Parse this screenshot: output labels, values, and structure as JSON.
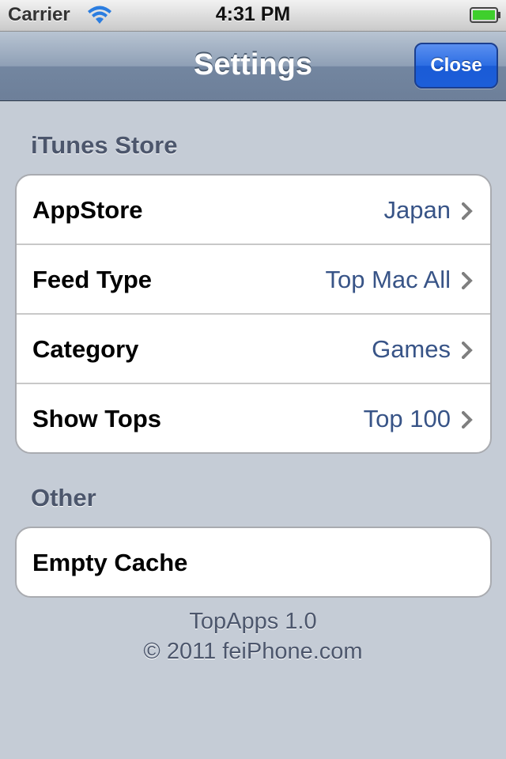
{
  "status_bar": {
    "carrier": "Carrier",
    "time": "4:31 PM",
    "wifi_icon": "wifi-icon",
    "battery_icon": "battery-full-icon",
    "battery_color": "#3fcf2d"
  },
  "nav_bar": {
    "title": "Settings",
    "close_label": "Close",
    "accent_color": "#1c5ed9"
  },
  "sections": {
    "itunes": {
      "header": "iTunes Store",
      "rows": [
        {
          "label": "AppStore",
          "value": "Japan"
        },
        {
          "label": "Feed Type",
          "value": "Top Mac All"
        },
        {
          "label": "Category",
          "value": "Games"
        },
        {
          "label": "Show Tops",
          "value": "Top 100"
        }
      ]
    },
    "other": {
      "header": "Other",
      "rows": [
        {
          "label": "Empty Cache"
        }
      ]
    }
  },
  "footer": {
    "version": "TopApps 1.0",
    "copyright": "© 2011 feiPhone.com"
  },
  "colors": {
    "background": "#c5ccd6",
    "value_text": "#385487",
    "section_header": "#4c566c"
  }
}
